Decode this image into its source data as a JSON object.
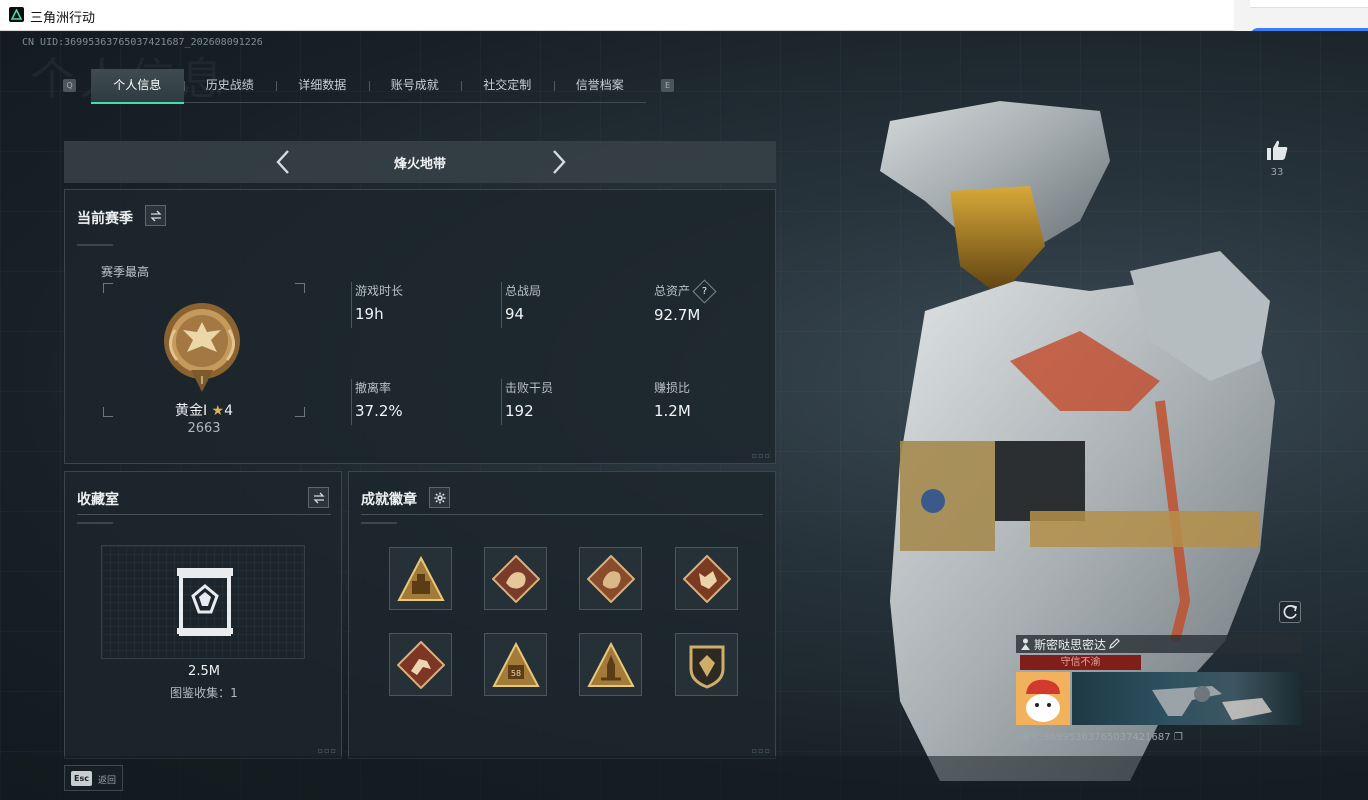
{
  "window": {
    "title": "三角洲行动"
  },
  "header": {
    "uid": "CN UID:3699536376503742168​7_202608091226",
    "watermark": "个人信息"
  },
  "tabs": [
    {
      "label": "个人信息",
      "active": true
    },
    {
      "label": "历史战绩"
    },
    {
      "label": "详细数据"
    },
    {
      "label": "账号成就"
    },
    {
      "label": "社交定制"
    },
    {
      "label": "信誉档案"
    }
  ],
  "tab_keys": {
    "prev": "Q",
    "next": "E"
  },
  "mode": {
    "title": "烽火地带"
  },
  "season": {
    "title": "当前赛季",
    "best_label": "赛季最高",
    "rank_name": "黄金I",
    "rank_stars": "4",
    "rank_score": "2663",
    "stats": [
      {
        "label": "游戏时长",
        "value": "19h"
      },
      {
        "label": "总战局",
        "value": "94"
      },
      {
        "label": "总资产",
        "value": "92.7M",
        "help": "?"
      },
      {
        "label": "撤离率",
        "value": "37.2%"
      },
      {
        "label": "击败干员",
        "value": "192"
      },
      {
        "label": "赚损比",
        "value": "1.2M"
      }
    ]
  },
  "collection": {
    "title": "收藏室",
    "amount": "2.5M",
    "caption": "图鉴收集：1"
  },
  "badges": {
    "title": "成就徽章",
    "items": [
      {
        "icon": "triangle-ammo-icon"
      },
      {
        "icon": "dragon-diamond-icon"
      },
      {
        "icon": "dragon-diamond-icon-2"
      },
      {
        "icon": "wolf-diamond-icon"
      },
      {
        "icon": "runner-diamond-icon"
      },
      {
        "icon": "triangle-58-icon",
        "text": "58"
      },
      {
        "icon": "triangle-rocket-icon"
      },
      {
        "icon": "shield-emblem-icon"
      }
    ]
  },
  "likes": {
    "count": "33"
  },
  "player": {
    "name": "斯密哒思密达",
    "status": "守信不渝",
    "id_line": "编号:369953637650374216​87"
  },
  "footer": {
    "esc_key": "Esc",
    "back_label": "返回"
  },
  "colors": {
    "accent": "#3fe0a8",
    "status_red": "#7f1e1b",
    "gold": "#d9b25a"
  }
}
